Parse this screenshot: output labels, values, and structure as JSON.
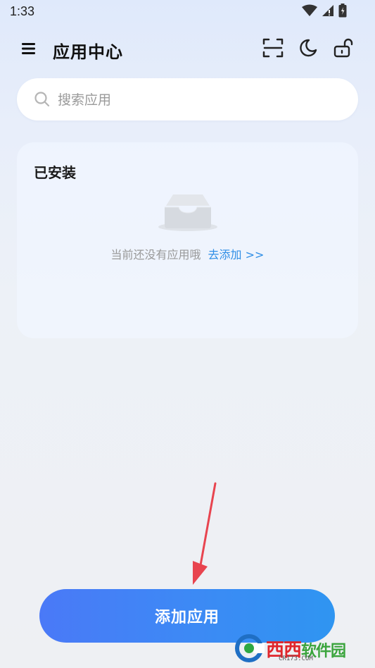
{
  "status_bar": {
    "time": "1:33",
    "icons": [
      "wifi-icon",
      "signal-icon",
      "battery-icon"
    ]
  },
  "header": {
    "title": "应用中心",
    "icons": [
      "menu-icon",
      "scan-icon",
      "moon-icon",
      "unlock-icon"
    ]
  },
  "search": {
    "placeholder": "搜索应用",
    "icon": "search-icon"
  },
  "installed": {
    "title": "已安装",
    "empty_text": "当前还没有应用哦",
    "add_link": "去添加 >>",
    "illustration": "empty-inbox-icon"
  },
  "footer": {
    "add_button": "添加应用"
  },
  "watermark": {
    "brand": "西西",
    "suffix": "软件园",
    "domain": "CR173.COM"
  },
  "colors": {
    "accent": "#2f8ee6",
    "button_start": "#4a79f7",
    "button_end": "#2f95f1",
    "annotation_arrow": "#e8444f"
  }
}
